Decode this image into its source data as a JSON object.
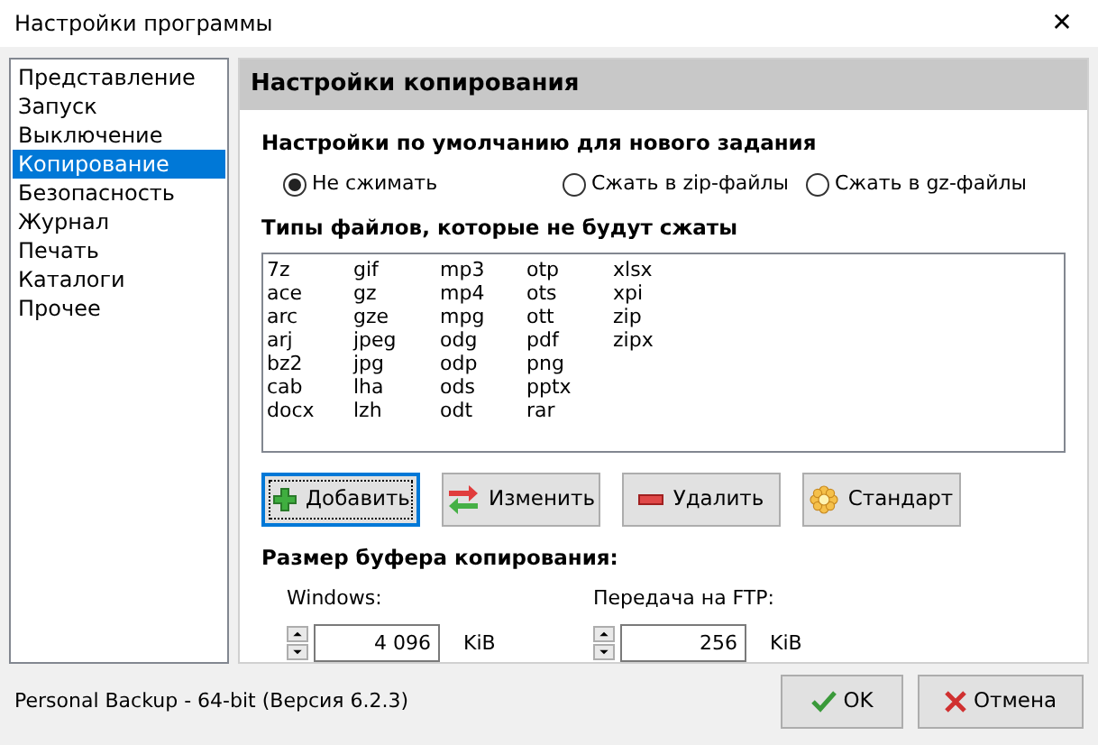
{
  "window": {
    "title": "Настройки программы",
    "close": "✕"
  },
  "sidebar": {
    "items": [
      {
        "label": "Представление",
        "selected": false
      },
      {
        "label": "Запуск",
        "selected": false
      },
      {
        "label": "Выключение",
        "selected": false
      },
      {
        "label": "Копирование",
        "selected": true
      },
      {
        "label": "Безопасность",
        "selected": false
      },
      {
        "label": "Журнал",
        "selected": false
      },
      {
        "label": "Печать",
        "selected": false
      },
      {
        "label": "Каталоги",
        "selected": false
      },
      {
        "label": "Прочее",
        "selected": false
      }
    ]
  },
  "panel": {
    "title": "Настройки копирования",
    "defaults_heading": "Настройки по умолчанию для нового задания",
    "radios": [
      {
        "label": "Не сжимать",
        "selected": true
      },
      {
        "label": "Сжать в zip-файлы",
        "selected": false
      },
      {
        "label": "Сжать в gz-файлы",
        "selected": false
      }
    ],
    "file_types_heading": "Типы файлов, которые не будут сжаты",
    "file_types": [
      [
        "7z",
        "ace",
        "arc",
        "arj",
        "bz2",
        "cab",
        "docx"
      ],
      [
        "gif",
        "gz",
        "gze",
        "jpeg",
        "jpg",
        "lha",
        "lzh"
      ],
      [
        "mp3",
        "mp4",
        "mpg",
        "odg",
        "odp",
        "ods",
        "odt"
      ],
      [
        "otp",
        "ots",
        "ott",
        "pdf",
        "png",
        "pptx",
        "rar"
      ],
      [
        "xlsx",
        "xpi",
        "zip",
        "zipx"
      ]
    ],
    "buttons": [
      {
        "kind": "add",
        "label": "Добавить",
        "focused": true
      },
      {
        "kind": "edit",
        "label": "Изменить",
        "focused": false
      },
      {
        "kind": "delete",
        "label": "Удалить",
        "focused": false
      },
      {
        "kind": "default",
        "label": "Стандарт",
        "focused": false
      }
    ],
    "buffer_heading": "Размер буфера копирования:",
    "spinners": [
      {
        "label": "Windows:",
        "value": "4 096",
        "unit": "KiB"
      },
      {
        "label": "Передача на FTP:",
        "value": "256",
        "unit": "KiB"
      }
    ]
  },
  "status_text": "Personal Backup - 64-bit (Версия 6.2.3)",
  "dialog_buttons": [
    {
      "kind": "ok",
      "label": "OK"
    },
    {
      "kind": "cancel",
      "label": "Отмена"
    }
  ]
}
